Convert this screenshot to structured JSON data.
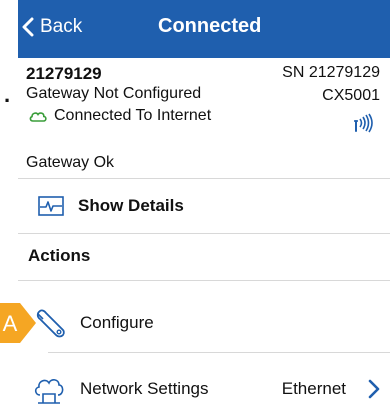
{
  "nav": {
    "back_label": "Back",
    "title": "Connected"
  },
  "device": {
    "id": "21279129",
    "status": "Gateway Not Configured",
    "connection": "Connected To Internet",
    "serial": "SN 21279129",
    "model": "CX5001",
    "health": "Gateway Ok"
  },
  "details": {
    "label": "Show Details"
  },
  "actions": {
    "heading": "Actions",
    "configure": "Configure",
    "network": "Network Settings",
    "network_value": "Ethernet"
  },
  "annotation": {
    "badge": "A",
    "margin_mark": "."
  },
  "colors": {
    "nav": "#1f5fae",
    "accent": "#1f5fae",
    "badge": "#f5a623",
    "connection_icon": "#3a9d3a"
  }
}
